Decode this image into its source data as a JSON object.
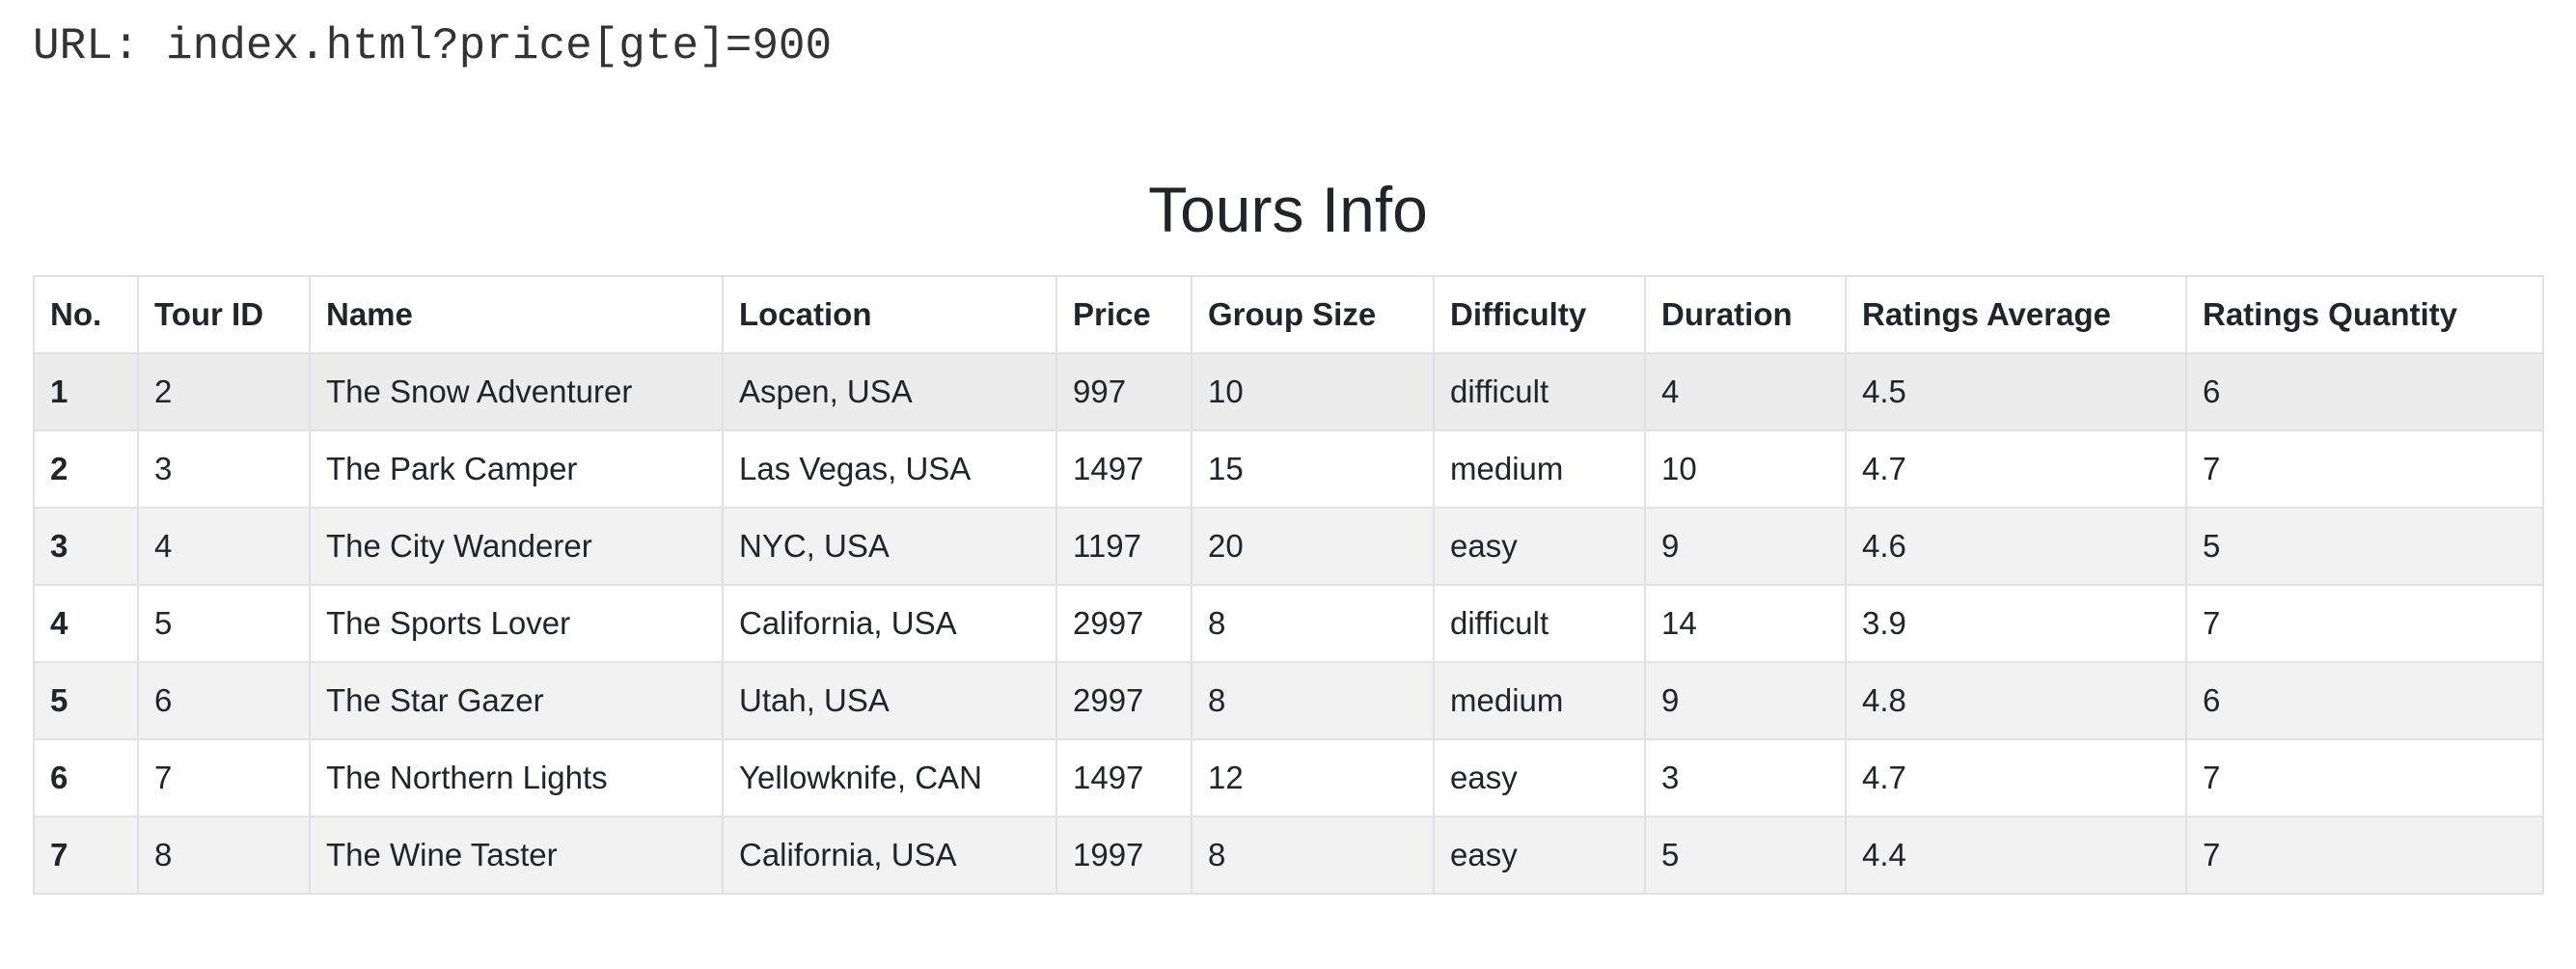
{
  "url_line": "URL: index.html?price[gte]=900",
  "title": "Tours Info",
  "table": {
    "headers": [
      "No.",
      "Tour ID",
      "Name",
      "Location",
      "Price",
      "Group Size",
      "Difficulty",
      "Duration",
      "Ratings Average",
      "Ratings Quantity"
    ],
    "rows": [
      [
        "1",
        "2",
        "The Snow Adventurer",
        "Aspen, USA",
        "997",
        "10",
        "difficult",
        "4",
        "4.5",
        "6"
      ],
      [
        "2",
        "3",
        "The Park Camper",
        "Las Vegas, USA",
        "1497",
        "15",
        "medium",
        "10",
        "4.7",
        "7"
      ],
      [
        "3",
        "4",
        "The City Wanderer",
        "NYC, USA",
        "1197",
        "20",
        "easy",
        "9",
        "4.6",
        "5"
      ],
      [
        "4",
        "5",
        "The Sports Lover",
        "California, USA",
        "2997",
        "8",
        "difficult",
        "14",
        "3.9",
        "7"
      ],
      [
        "5",
        "6",
        "The Star Gazer",
        "Utah, USA",
        "2997",
        "8",
        "medium",
        "9",
        "4.8",
        "6"
      ],
      [
        "6",
        "7",
        "The Northern Lights",
        "Yellowknife, CAN",
        "1497",
        "12",
        "easy",
        "3",
        "4.7",
        "7"
      ],
      [
        "7",
        "8",
        "The Wine Taster",
        "California, USA",
        "1997",
        "8",
        "easy",
        "5",
        "4.4",
        "7"
      ]
    ]
  }
}
